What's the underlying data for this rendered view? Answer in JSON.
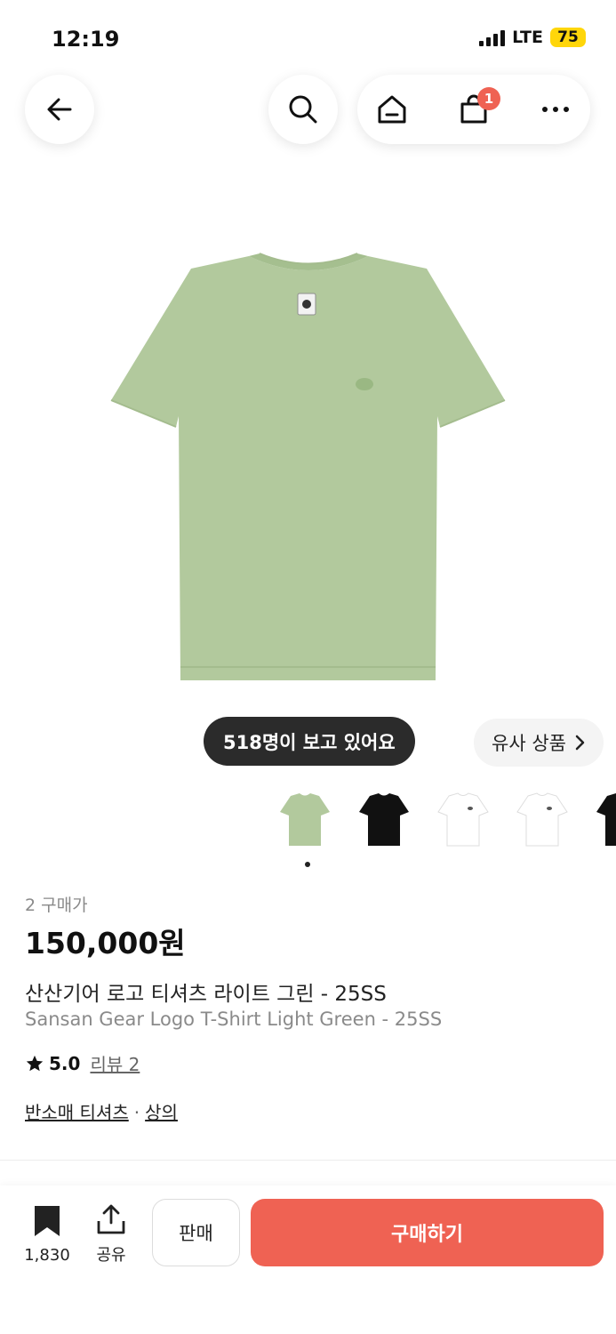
{
  "status_bar": {
    "time": "12:19",
    "network": "LTE",
    "battery": "75"
  },
  "header": {
    "back_icon": "arrow-left-icon",
    "search_icon": "search-icon",
    "home_icon": "home-icon",
    "cart_icon": "shopping-bag-icon",
    "cart_badge": "1",
    "more_icon": "more-horizontal-icon"
  },
  "gallery": {
    "viewers_text": "518명이 보고 있어요",
    "similar_label": "유사 상품",
    "thumbnails": [
      {
        "color": "#b2c99d",
        "selected": true
      },
      {
        "color": "#111111"
      },
      {
        "color": "#ffffff"
      },
      {
        "color": "#ffffff"
      },
      {
        "color": "#111111"
      }
    ]
  },
  "product": {
    "buyers_count": "2",
    "buyers_label": "구매가",
    "price": "150,000원",
    "name_ko": "산산기어 로고 티셔츠 라이트 그린 - 25SS",
    "name_en": "Sansan Gear Logo T-Shirt Light Green - 25SS",
    "rating": "5.0",
    "review_label": "리뷰 2",
    "category_primary": "반소매 티셔츠",
    "category_separator": "·",
    "category_secondary": "상의"
  },
  "bottom_bar": {
    "bookmark_count": "1,830",
    "share_label": "공유",
    "sell_label": "판매",
    "buy_label": "구매하기"
  },
  "colors": {
    "accent": "#ef6253",
    "shirt": "#b2c99d",
    "dark_pill": "#2b2b2b"
  }
}
